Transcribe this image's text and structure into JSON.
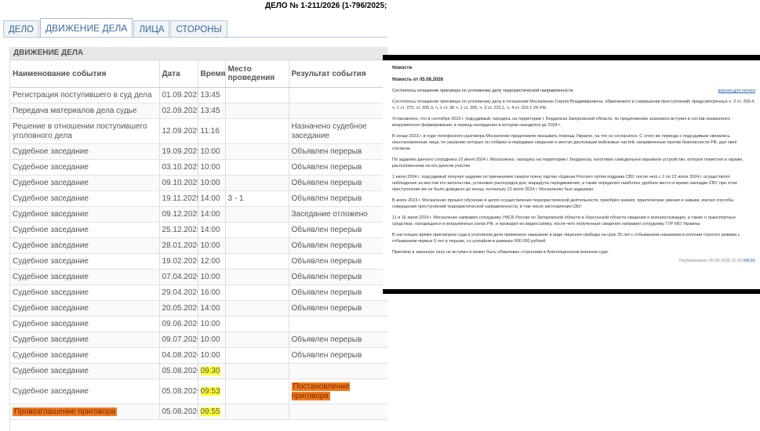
{
  "case_title": "ДЕЛО № 1-211/2026 (1-796/2025;",
  "tabs": [
    {
      "label": "ДЕЛО",
      "active": false
    },
    {
      "label": "ДВИЖЕНИЕ ДЕЛА",
      "active": true
    },
    {
      "label": "ЛИЦА",
      "active": false
    },
    {
      "label": "СТОРОНЫ",
      "active": false
    }
  ],
  "section_title": "ДВИЖЕНИЕ ДЕЛА",
  "columns": [
    "Наименование события",
    "Дата",
    "Время",
    "Место проведения",
    "Результат события"
  ],
  "rows": [
    {
      "event": "Регистрация поступившего в суд дела",
      "date": "01.09.2025",
      "time": "13:45",
      "place": "",
      "result": ""
    },
    {
      "event": "Передача материалов дела судье",
      "date": "02.09.2025",
      "time": "13:45",
      "place": "",
      "result": ""
    },
    {
      "event": "Решение в отношении поступившего уголовного дела",
      "date": "12.09.2025",
      "time": "11:16",
      "place": "",
      "result": "Назначено судебное заседание"
    },
    {
      "event": "Судебное заседание",
      "date": "19.09.2025",
      "time": "10:00",
      "place": "",
      "result": "Объявлен перерыв"
    },
    {
      "event": "Судебное заседание",
      "date": "03.10.2025",
      "time": "10:00",
      "place": "",
      "result": "Объявлен перерыв"
    },
    {
      "event": "Судебное заседание",
      "date": "09.10.2025",
      "time": "10:00",
      "place": "",
      "result": "Объявлен перерыв"
    },
    {
      "event": "Судебное заседание",
      "date": "19.11.2025",
      "time": "14:00",
      "place": "3 - 1",
      "result": "Объявлен перерыв"
    },
    {
      "event": "Судебное заседание",
      "date": "09.12.2025",
      "time": "14:00",
      "place": "",
      "result": "Заседание отложено"
    },
    {
      "event": "Судебное заседание",
      "date": "25.12.2025",
      "time": "14:00",
      "place": "",
      "result": "Объявлен перерыв"
    },
    {
      "event": "Судебное заседание",
      "date": "28.01.2026",
      "time": "10:00",
      "place": "",
      "result": "Объявлен перерыв"
    },
    {
      "event": "Судебное заседание",
      "date": "19.02.2026",
      "time": "12:00",
      "place": "",
      "result": "Объявлен перерыв"
    },
    {
      "event": "Судебное заседание",
      "date": "07.04.2026",
      "time": "10:00",
      "place": "",
      "result": "Объявлен перерыв"
    },
    {
      "event": "Судебное заседание",
      "date": "29.04.2026",
      "time": "16:00",
      "place": "",
      "result": "Объявлен перерыв"
    },
    {
      "event": "Судебное заседание",
      "date": "20.05.2026",
      "time": "14:00",
      "place": "",
      "result": "Объявлен перерыв"
    },
    {
      "event": "Судебное заседание",
      "date": "09.06.2026",
      "time": "10:00",
      "place": "",
      "result": ""
    },
    {
      "event": "Судебное заседание",
      "date": "09.07.2026",
      "time": "10:00",
      "place": "",
      "result": "Объявлен перерыв"
    },
    {
      "event": "Судебное заседание",
      "date": "04.08.2026",
      "time": "10:00",
      "place": "",
      "result": "Объявлен перерыв"
    },
    {
      "event": "Судебное заседание",
      "date": "05.08.2026",
      "time": "09:30",
      "place": "",
      "result": "",
      "hl_time": true
    },
    {
      "event": "Судебное заседание",
      "date": "05.08.2026",
      "time": "09:53",
      "place": "",
      "result": "Постановление приговора",
      "hl_time": true,
      "hl_result": true
    },
    {
      "event": "Провозглашение приговора",
      "date": "05.08.2026",
      "time": "09:55",
      "place": "",
      "result": "",
      "hl_time": true,
      "hl_event": true
    }
  ],
  "news": {
    "caption": "Новости",
    "date_line": "Новость от 05.08.2026",
    "subtitle": "Состоялось оглашение приговора по уголовному делу террористической направленности",
    "print_link": "версия для печати",
    "paragraphs": [
      "Состоялось оглашение приговора по уголовному делу в отношении Москаленко Сергея Владимировича, обвиняемого в совершении преступлений, предусмотренных ч. 2 ст. 205.4, ч. 1 ст. 275, ст. 205.3, ч. 1 ст. 30 ч. 1 ст. 205, ч. 3 ст. 222.1, ч. 4 ст. 222.1 УК РФ.",
      "Установлено, что в сентябре 2023 г. подсудимый, находясь на территории г. Бердянска Запорожской области, по предложению знакомого вступил в состав незаконного вооружённого формирования, в период нахождения в котором находился до 2024 г.",
      "В конце 2023 г. в ходе телефонного разговора Москаленко предложили оказывать помощь Украине, на что он согласился. С этого же периода с подсудимым связались неустановленные лица, по указанию которых он собирал и передавал сведения о местах дислокации войсковых частей, направленные против безопасности РФ, дал своё согласие.",
      "По заданию данного сотрудника 10 июня 2024 г. Москаленко, находясь на территории г. Бердянска, изготовил самодельное взрывное устройство, которое поместил в гараже, расположенном на его дачном участке.",
      "1 июля 2024 г. подсудимый получил задание по причинению смерти члену партии «Единая Россия» путём подрыва СВУ, после чего с 2 по 22 июля 2024 г. осуществлял наблюдение за местом его жительства, установил распорядок дня, маршруты передвижения, а также определил наиболее удобное место и время закладки СВУ, при этом преступление им не было доведено до конца, поскольку 22 июля 2024 г. Москаленко был задержан.",
      "В июле 2024 г. Москаленко прошёл обучение в целях осуществления террористической деятельности, приобрёл знания, практические умения и навыки, изучил способы совершения преступлений террористической направленности, в том числе изготовления СВУ.",
      "11 и 16 июля 2024 г. Москаленко направил сотруднику УФСБ России по Запорожской области и Херсонской области сведения о военнослужащих, а также о транспортных средствах, находящихся в вооружённых силах РФ, и проводил их видеосъёмку, после чего полученные сведения направил сотруднику ГУР МО Украины.",
      "В настоящее время приговором суда в уголовном деле применено наказание в виде лишения свободы на срок 25 лет с отбыванием наказания в колонии строгого режима с отбыванием первых 5 лет в тюрьме, со штрафом в размере 600 000 рублей.",
      "Приговор в законную силу не вступил и может быть обжалован сторонами в Апелляционном военном суде."
    ],
    "footer_text": "Опубликовано 05.08.2026 11:20",
    "footer_author": "(МСК)"
  }
}
